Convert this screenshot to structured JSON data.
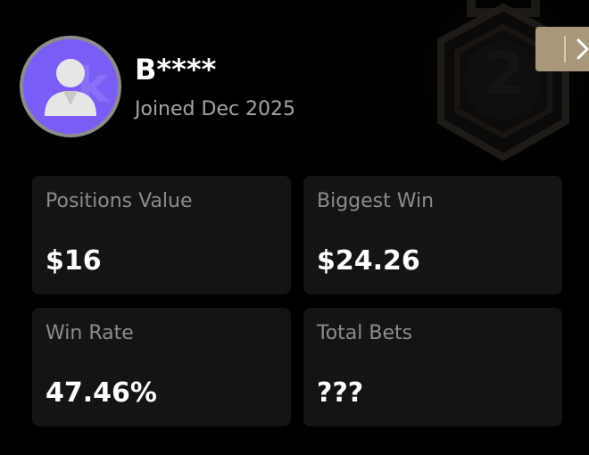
{
  "profile": {
    "username": "B****",
    "joined": "Joined Dec 2025"
  },
  "rank": {
    "number": "2"
  },
  "stats": [
    {
      "label": "Positions Value",
      "value": "$16"
    },
    {
      "label": "Biggest Win",
      "value": "$24.26"
    },
    {
      "label": "Win Rate",
      "value": "47.46%"
    },
    {
      "label": "Total Bets",
      "value": "???"
    }
  ],
  "icons": {
    "next": "chevron-right-icon",
    "avatar": "user-icon",
    "rank": "medal-badge-icon"
  },
  "colors": {
    "background": "#000000",
    "card": "#141414",
    "avatar": "#7b5cf5",
    "tab": "#a89779",
    "label": "#8c8c8c",
    "value": "#ffffff"
  }
}
